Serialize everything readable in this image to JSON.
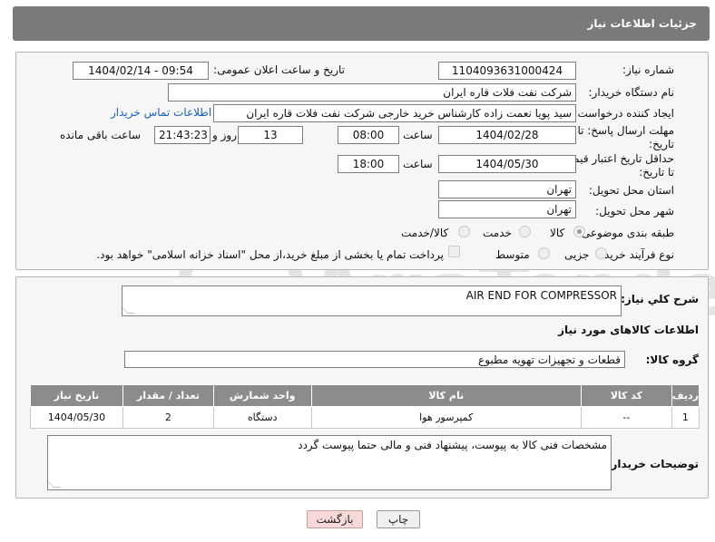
{
  "header": {
    "title": "جزئیات اطلاعات نیاز"
  },
  "form": {
    "need_number_label": "شماره نیاز:",
    "need_number": "1104093631000424",
    "announce_label": "تاریخ و ساعت اعلان عمومی:",
    "announce_value": "1404/02/14 - 09:54",
    "buyer_label": "نام دستگاه خریدار:",
    "buyer_value": "شرکت نفت فلات قاره ایران",
    "creator_label": "ایجاد کننده درخواست:",
    "creator_value": "سید پویا نعمت زاده کارشناس خرید خارجی شرکت نفت فلات قاره ایران",
    "contact_link": "اطلاعات تماس خریدار",
    "deadline_label_1": "مهلت ارسال پاسخ: تا",
    "deadline_label_2": "تاریخ:",
    "deadline_date": "1404/02/28",
    "time_label": "ساعت",
    "deadline_time": "08:00",
    "days_value": "13",
    "days_label": "روز و",
    "remaining_value": "21:43:23",
    "remaining_label": "ساعت باقی مانده",
    "validity_label_1": "حداقل تاریخ اعتبار قیمت:",
    "validity_label_2": "تا تاریخ:",
    "validity_date": "1404/05/30",
    "validity_time": "18:00",
    "province_label": "استان محل تحویل:",
    "province_value": "تهران",
    "city_label": "شهر محل تحویل:",
    "city_value": "تهران",
    "category_label": "طبقه بندی موضوعی:",
    "category_options": [
      "کالا",
      "خدمت",
      "کالا/خدمت"
    ],
    "category_selected": "کالا",
    "process_label": "نوع فرآیند خرید :",
    "process_options": [
      "جزیی",
      "متوسط"
    ],
    "payment_note": "پرداخت تمام یا بخشی از مبلغ خرید،از محل \"اسناد خزانه اسلامی\" خواهد بود."
  },
  "description": {
    "label": "شرح کلي نياز:",
    "value": "AIR END FOR COMPRESSOR",
    "items_title": "اطلاعات کالاهای مورد نیاز",
    "group_label": "گروه کالا:",
    "group_value": "قطعات و تجهیزات تهویه مطبوع"
  },
  "table": {
    "headers": [
      "ردیف",
      "کد کالا",
      "نام کالا",
      "واحد شمارش",
      "تعداد / مقدار",
      "تاریخ نیاز"
    ],
    "rows": [
      {
        "row": "1",
        "code": "--",
        "name": "کمپرسور هوا",
        "unit": "دستگاه",
        "qty": "2",
        "date": "1404/05/30"
      }
    ]
  },
  "buyer_notes": {
    "label": "توضیحات خریدار:",
    "value": "مشخصات فنی کالا به پیوست، پیشنهاد فنی و مالی حتما پیوست گردد"
  },
  "buttons": {
    "print": "چاپ",
    "back": "بازگشت"
  },
  "watermark": {
    "text": "AriaTender.net"
  }
}
